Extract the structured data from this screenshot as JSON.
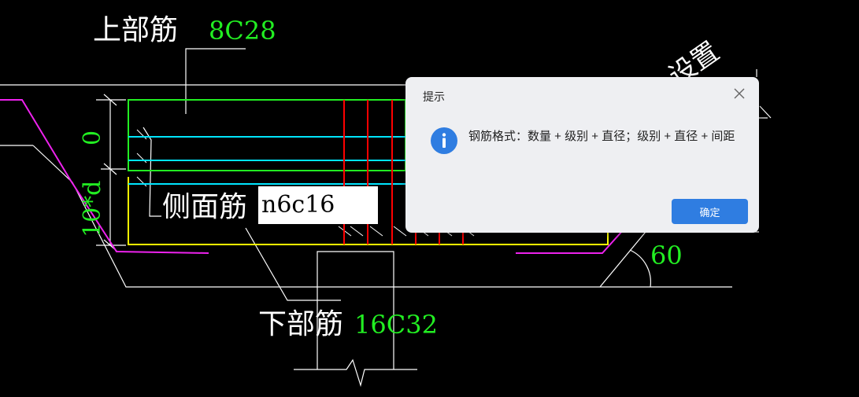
{
  "drawing": {
    "top_rebar_label": "上部筋",
    "top_rebar_value": "8C28",
    "side_rebar_label": "侧面筋",
    "bottom_rebar_label": "下部筋",
    "bottom_rebar_value": "16C32",
    "dim_upper": "0",
    "dim_lower": "10*d",
    "angle": "60",
    "settings_text": "设置"
  },
  "input": {
    "value": "n6c16"
  },
  "dialog": {
    "title": "提示",
    "message": "钢筋格式：数量 + 级别 + 直径；级别 + 直径 + 间距",
    "ok_label": "确定",
    "close_icon": "close-icon",
    "info_icon": "info-icon"
  },
  "colors": {
    "background": "#000000",
    "white_line": "#ffffff",
    "green": "#22ee22",
    "cyan": "#00e5ff",
    "yellow": "#ffff00",
    "red": "#ff0000",
    "magenta": "#ee22ee",
    "dialog_bg": "#eeeff2",
    "button_blue": "#2f7de1"
  }
}
